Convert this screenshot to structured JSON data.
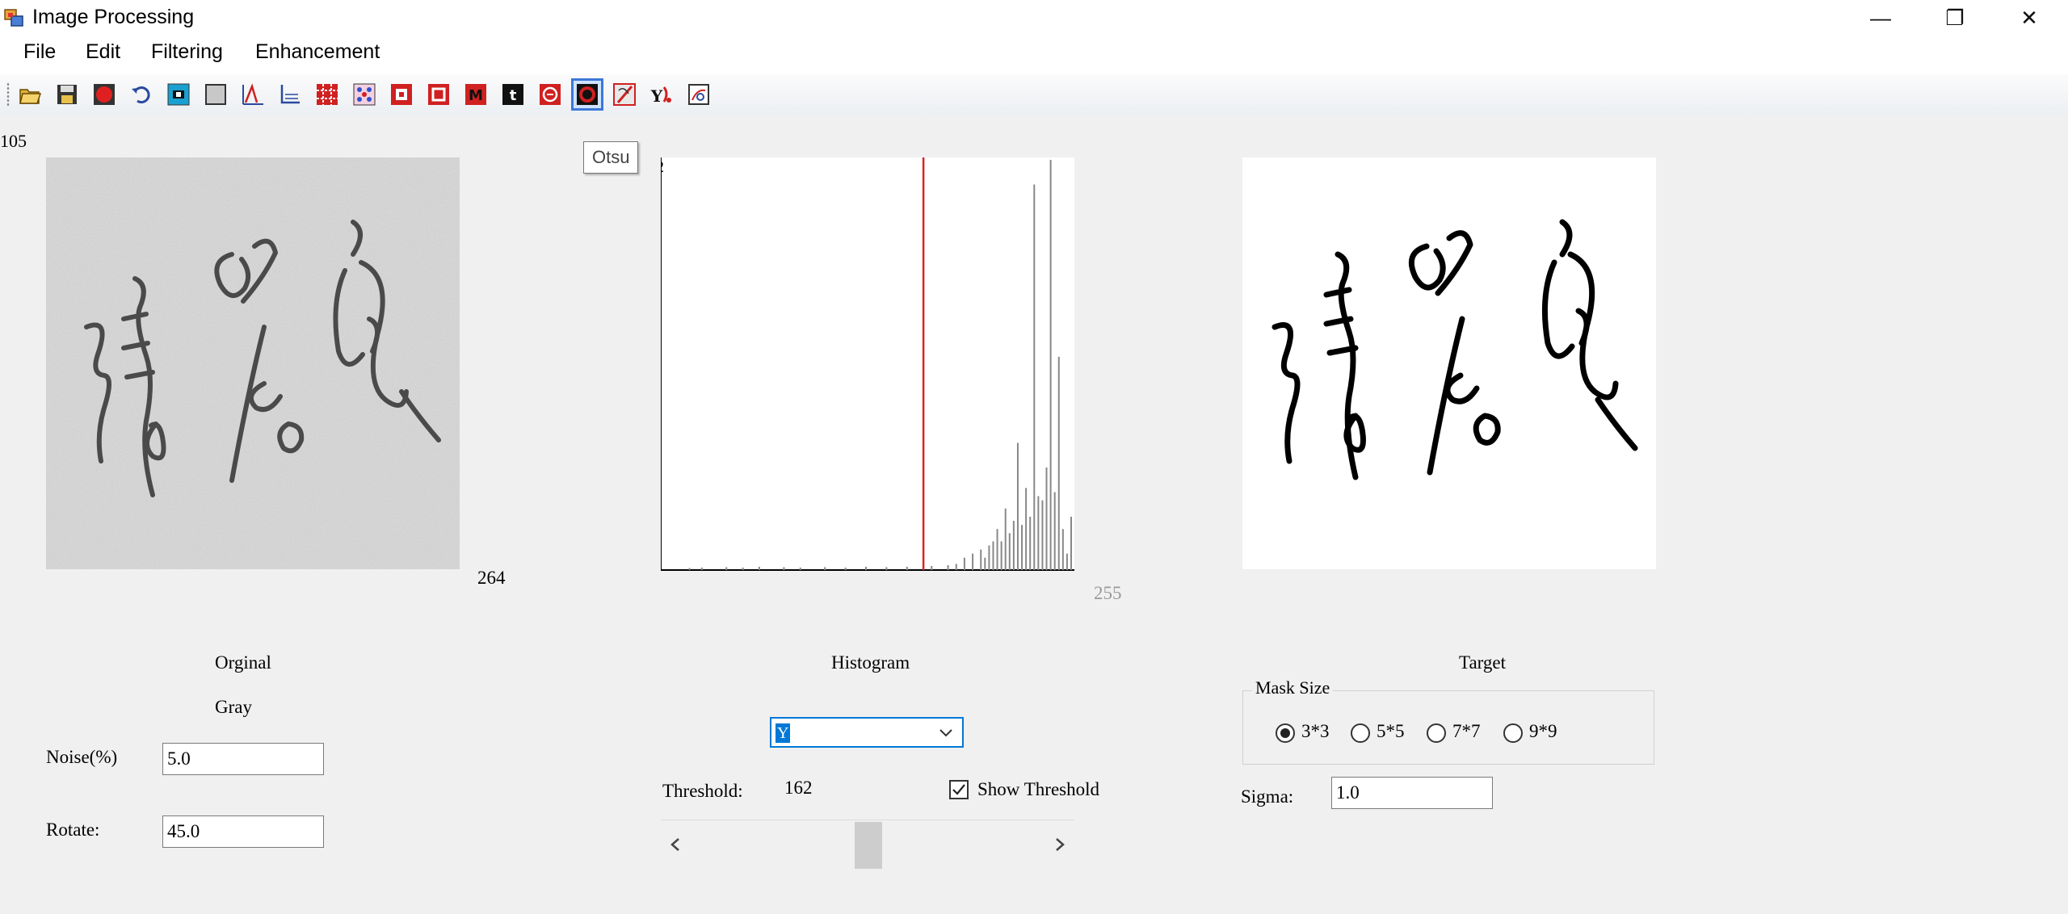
{
  "window": {
    "title": "Image Processing",
    "controls": {
      "minimize": "—",
      "restore": "❐",
      "close": "✕"
    }
  },
  "menu": [
    "File",
    "Edit",
    "Filtering",
    "Enhancement"
  ],
  "toolbar": {
    "icons": [
      "open-icon",
      "save-icon",
      "record-icon",
      "undo-icon",
      "negative-icon",
      "gray-square-icon",
      "histogram-icon",
      "axis-icon",
      "filter-a-icon",
      "filter-b-icon",
      "filter-c-icon",
      "filter-d-icon",
      "filter-m-icon",
      "text-t-icon",
      "filter-e-icon",
      "otsu-icon",
      "pen-icon",
      "y-channel-icon",
      "color-chart-icon"
    ],
    "active_tool": "otsu-icon",
    "tooltip": "Otsu"
  },
  "original": {
    "height_readout": "105",
    "width_readout": "264",
    "title": "Orginal",
    "mode": "Gray",
    "noise_label": "Noise(%)",
    "noise_value": "5.0",
    "rotate_label": "Rotate:",
    "rotate_value": "45.0"
  },
  "histogram": {
    "title": "Histogram",
    "y_max_label": "2",
    "x_max_label": "255",
    "channel": "Y",
    "threshold_label": "Threshold:",
    "threshold_value": "162",
    "show_threshold_label": "Show Threshold",
    "show_threshold_checked": true,
    "threshold_fraction": 0.635
  },
  "target": {
    "title": "Target",
    "mask_size_label": "Mask Size",
    "mask_options": [
      "3*3",
      "5*5",
      "7*7",
      "9*9"
    ],
    "mask_selected": "3*3",
    "sigma_label": "Sigma:",
    "sigma_value": "1.0"
  },
  "colors": {
    "accent": "#0078d7",
    "threshold_line": "#e02020",
    "window_bg": "#f0f0f0"
  }
}
